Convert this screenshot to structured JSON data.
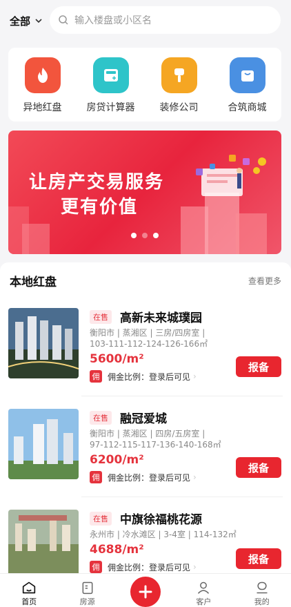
{
  "header": {
    "city": "全部",
    "search_placeholder": "输入楼盘或小区名"
  },
  "quick_entries": [
    {
      "label": "异地红盘",
      "icon": "fire-icon",
      "color": "#f2553d"
    },
    {
      "label": "房贷计算器",
      "icon": "calculator-icon",
      "color": "#2ec4c9"
    },
    {
      "label": "装修公司",
      "icon": "paint-roller-icon",
      "color": "#f5a623"
    },
    {
      "label": "合筑商城",
      "icon": "shopping-bag-icon",
      "color": "#4a90e2"
    }
  ],
  "banner": {
    "line1": "让房产交易服务",
    "line2": "更有价值",
    "slides": 3,
    "active_slide": 1
  },
  "section": {
    "title": "本地红盘",
    "more": "查看更多"
  },
  "listings": [
    {
      "status": "在售",
      "name": "高新未来城璞园",
      "meta1": "衡阳市 | 蒸湘区 | 三房/四房室 |",
      "meta2": "103-111-112-124-126-166㎡",
      "price": "5600/m²",
      "commission_tag": "佣",
      "commission": "佣金比例：登录后可见",
      "action": "报备"
    },
    {
      "status": "在售",
      "name": "融冠爱城",
      "meta1": "衡阳市 | 蒸湘区 | 四房/五房室 |",
      "meta2": "97-112-115-117-136-140-168㎡",
      "price": "6200/m²",
      "commission_tag": "佣",
      "commission": "佣金比例：登录后可见",
      "action": "报备"
    },
    {
      "status": "在售",
      "name": "中旗徐福桃花源",
      "meta1": "永州市 | 冷水滩区 | 3-4室 | 114-132㎡",
      "meta2": "",
      "price": "4688/m²",
      "commission_tag": "佣",
      "commission": "佣金比例：登录后可见",
      "action": "报备"
    }
  ],
  "tabs": [
    {
      "label": "首页",
      "icon": "home-icon"
    },
    {
      "label": "房源",
      "icon": "building-icon"
    },
    {
      "label": "",
      "icon": "plus-icon"
    },
    {
      "label": "客户",
      "icon": "customer-icon"
    },
    {
      "label": "我的",
      "icon": "profile-icon"
    }
  ],
  "colors": {
    "accent": "#e8262f",
    "price": "#e5333d"
  }
}
